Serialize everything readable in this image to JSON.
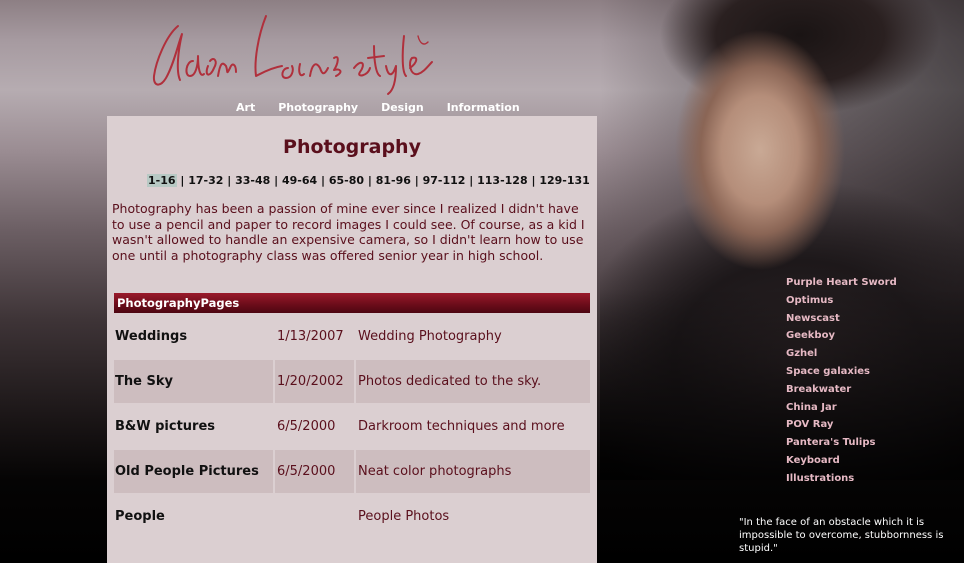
{
  "site": {
    "logo_text": "Adam Lein's style"
  },
  "topnav": [
    {
      "label": "Art"
    },
    {
      "label": "Photography"
    },
    {
      "label": "Design"
    },
    {
      "label": "Information"
    }
  ],
  "main": {
    "title": "Photography",
    "pager": {
      "current": "1-16",
      "pages": [
        "17-32",
        "33-48",
        "49-64",
        "65-80",
        "81-96",
        "97-112",
        "113-128",
        "129-131"
      ]
    },
    "intro": "Photography has been a passion of mine ever since I realized I didn't have to use a pencil and paper to record images I could see.  Of course, as a kid I wasn't allowed to handle an expensive camera, so I didn't learn how to use one until a photography class was offered senior year in high school.",
    "section_title": "PhotographyPages",
    "rows": [
      {
        "name": "Weddings",
        "date": "1/13/2007",
        "desc": "Wedding Photography"
      },
      {
        "name": "The Sky",
        "date": "1/20/2002",
        "desc": "Photos dedicated to the sky."
      },
      {
        "name": "B&W pictures",
        "date": "6/5/2000",
        "desc": "Darkroom techniques and more"
      },
      {
        "name": "Old People Pictures",
        "date": "6/5/2000",
        "desc": "Neat color photographs"
      },
      {
        "name": "People",
        "date": "",
        "desc": "People Photos"
      }
    ]
  },
  "sidebar": {
    "links": [
      "Purple Heart Sword",
      "Optimus",
      "Newscast",
      "Geekboy",
      "Gzhel",
      "Space galaxies",
      "Breakwater",
      "China Jar",
      "POV Ray",
      "Pantera's Tulips",
      "Keyboard",
      "Illustrations"
    ]
  },
  "quote": "\"In the face of an obstacle which it is impossible to overcome, stubbornness is stupid.\"",
  "colors": {
    "accent": "#5a0f1c",
    "panel": "#dbcfd1",
    "header_bar": "#6e0d1b",
    "side_link": "#e6b9c4"
  }
}
